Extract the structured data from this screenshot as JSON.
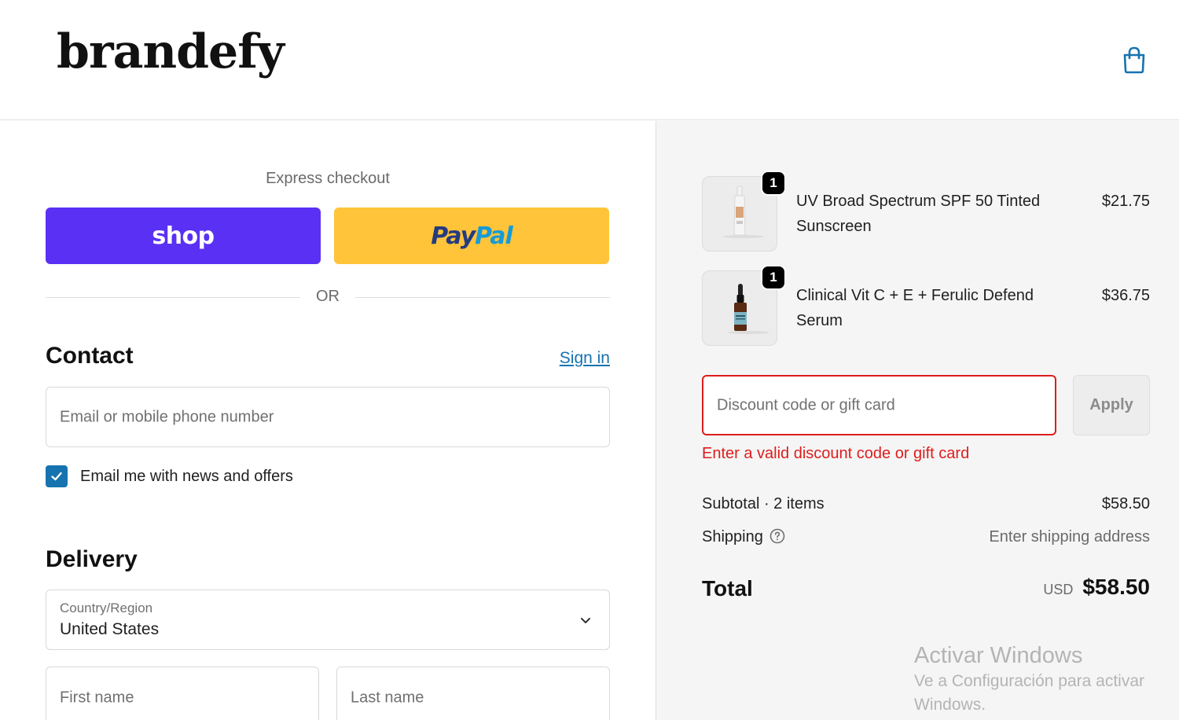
{
  "header": {
    "logo_text": "brandefy",
    "cart_icon": "shopping-bag-icon",
    "accent_color": "#1773b0"
  },
  "express": {
    "label": "Express checkout",
    "shop_button_label": "shop",
    "shop_color": "#5a31f4",
    "paypal_label_a": "Pay",
    "paypal_label_b": "Pal",
    "paypal_color": "#ffc439",
    "or_text": "OR"
  },
  "contact": {
    "heading": "Contact",
    "sign_in": "Sign in",
    "email_placeholder": "Email or mobile phone number",
    "newsletter_checked": true,
    "newsletter_label": "Email me with news and offers"
  },
  "delivery": {
    "heading": "Delivery",
    "country_label": "Country/Region",
    "country_value": "United States",
    "first_name_placeholder": "First name",
    "last_name_placeholder": "Last name"
  },
  "order": {
    "items": [
      {
        "name": "UV Broad Spectrum SPF 50 Tinted Sunscreen",
        "price": "$21.75",
        "quantity": "1"
      },
      {
        "name": "Clinical Vit C + E + Ferulic Defend Serum",
        "price": "$36.75",
        "quantity": "1"
      }
    ],
    "discount_placeholder": "Discount code or gift card",
    "apply_label": "Apply",
    "discount_error": "Enter a valid discount code or gift card",
    "error_color": "#dd1d1d",
    "subtotal_label": "Subtotal · 2 items",
    "subtotal_value": "$58.50",
    "shipping_label": "Shipping",
    "shipping_help_icon": "question-circle-icon",
    "shipping_value": "Enter shipping address",
    "total_label": "Total",
    "total_currency": "USD",
    "total_value": "$58.50"
  },
  "watermark": {
    "title": "Activar Windows",
    "subtitle": "Ve a Configuración para activar Windows."
  }
}
